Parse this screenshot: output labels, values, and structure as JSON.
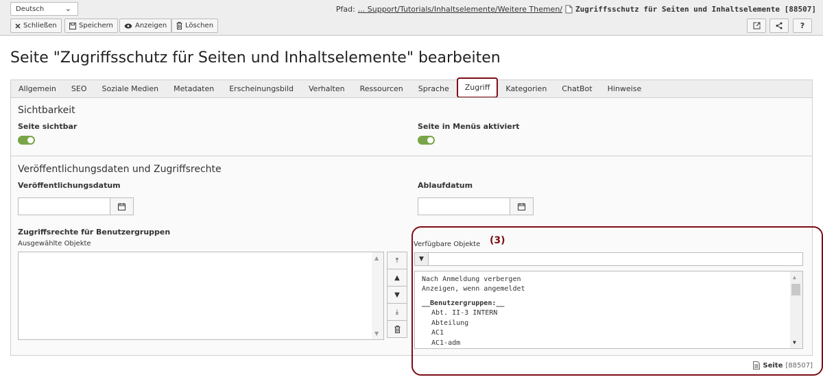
{
  "header": {
    "language": "Deutsch",
    "buttons": {
      "close": "Schließen",
      "save": "Speichern",
      "view": "Anzeigen",
      "delete": "Löschen"
    },
    "path_label": "Pfad:",
    "path_link": "... Support/Tutorials/Inhaltselemente/Weitere Themen/",
    "path_title": "Zugriffsschutz für Seiten und Inhaltselemente [88507]",
    "help": "?"
  },
  "page_title": "Seite \"Zugriffsschutz für Seiten und Inhaltselemente\" bearbeiten",
  "tabs": [
    "Allgemein",
    "SEO",
    "Soziale Medien",
    "Metadaten",
    "Erscheinungsbild",
    "Verhalten",
    "Ressourcen",
    "Sprache",
    "Zugriff",
    "Kategorien",
    "ChatBot",
    "Hinweise"
  ],
  "active_tab": "Zugriff",
  "visibility": {
    "title": "Sichtbarkeit",
    "page_visible": "Seite sichtbar",
    "menu_enabled": "Seite in Menüs aktiviert",
    "page_visible_on": true,
    "menu_enabled_on": true
  },
  "publication": {
    "title": "Veröffentlichungsdaten und Zugriffsrechte",
    "publish_date": "Veröffentlichungsdatum",
    "expiry_date": "Ablaufdatum",
    "publish_value": "",
    "expiry_value": ""
  },
  "access": {
    "label": "Zugriffsrechte für Benutzergruppen",
    "selected_label": "Ausgewählte Objekte",
    "available_label": "Verfügbare Objekte",
    "marker": "(3)",
    "filter_value": "",
    "options": [
      "Nach Anmeldung verbergen",
      "Anzeigen, wenn angemeldet"
    ],
    "group_header": "__Benutzergruppen:__",
    "groups": [
      "Abt. II-3 INTERN",
      "Abteilung",
      "AC1",
      "AC1-adm"
    ]
  },
  "record": {
    "type": "Seite",
    "id": "[88507]"
  },
  "colors": {
    "highlight": "#7a0d15",
    "toggle_on": "#79a548"
  }
}
